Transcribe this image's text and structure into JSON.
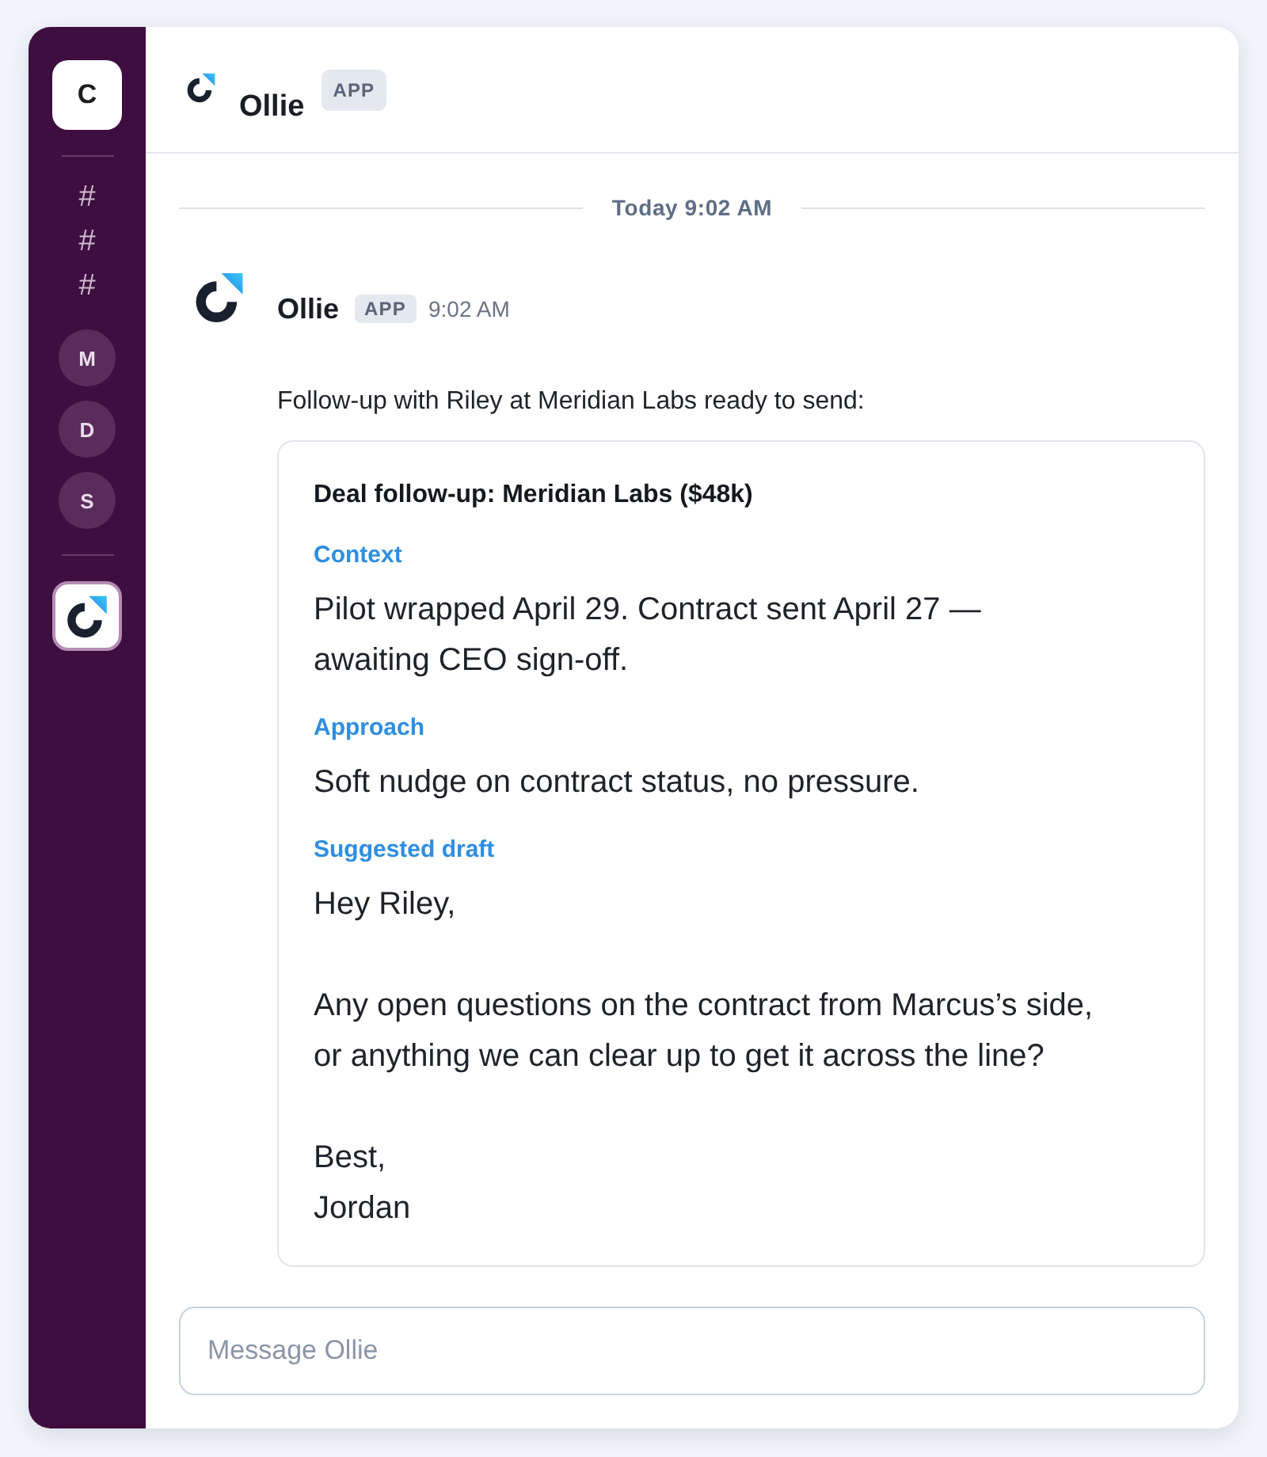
{
  "sidebar": {
    "workspace": {
      "label": "C"
    },
    "groups": [
      {
        "items": [
          {
            "kind": "channel",
            "label": "#",
            "selected": false
          },
          {
            "kind": "channel",
            "label": "#",
            "selected": false
          },
          {
            "kind": "channel",
            "label": "#",
            "selected": false
          },
          {
            "kind": "dm",
            "label": "M",
            "selected": false
          },
          {
            "kind": "dm",
            "label": "D",
            "selected": false
          },
          {
            "kind": "dm",
            "label": "S",
            "selected": false
          }
        ]
      },
      {
        "items": [
          {
            "kind": "app",
            "selected": true
          }
        ]
      }
    ]
  },
  "header": {
    "title": "Ollie",
    "badge": "APP"
  },
  "date_divider": "Today 9:02 AM",
  "message": {
    "author": "Ollie",
    "badge": "APP",
    "time": "9:02 AM",
    "text": "Follow-up with Riley at Meridian Labs ready to send:",
    "card": {
      "title": "Deal follow-up: Meridian Labs ($48k)",
      "sections": [
        {
          "heading": "Context",
          "paragraphs": [
            "Pilot wrapped April 29. Contract sent April 27 — awaiting CEO sign-off."
          ]
        },
        {
          "heading": "Approach",
          "paragraphs": [
            "Soft nudge on contract status, no pressure."
          ]
        },
        {
          "heading": "Suggested draft",
          "paragraphs": [
            "Hey Riley,",
            "Any open questions on the contract from Marcus’s side, or anything we can clear up to get it across the line?",
            "Best,\nJordan"
          ]
        }
      ]
    }
  },
  "composer": {
    "placeholder": "Message Ollie"
  }
}
